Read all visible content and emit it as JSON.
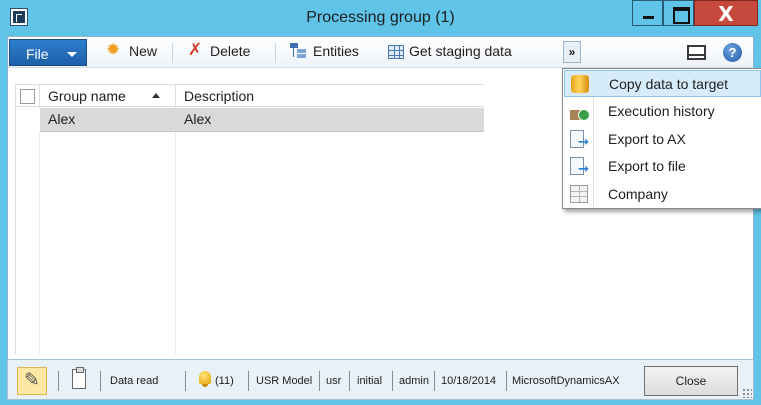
{
  "window": {
    "title": "Processing group (1)",
    "close_glyph": "X"
  },
  "toolbar": {
    "file_label": "File",
    "new_label": "New",
    "delete_label": "Delete",
    "entities_label": "Entities",
    "get_staging_label": "Get staging data",
    "more_glyph": "»",
    "help_glyph": "?"
  },
  "grid": {
    "columns": [
      "Group name",
      "Description"
    ],
    "sort_column": "Group name",
    "sort_direction": "ascending",
    "rows": [
      {
        "group_name": "Alex",
        "description": "Alex",
        "selected": true
      }
    ]
  },
  "menu": {
    "items": [
      {
        "label": "Copy data to target",
        "icon": "cylinder-icon",
        "active": true
      },
      {
        "label": "Execution history",
        "icon": "history-icon",
        "active": false
      },
      {
        "label": "Export to AX",
        "icon": "export-document-icon",
        "active": false
      },
      {
        "label": "Export to file",
        "icon": "export-document-icon",
        "active": false
      },
      {
        "label": "Company",
        "icon": "company-grid-icon",
        "active": false
      }
    ]
  },
  "statusbar": {
    "status": "Data read",
    "notifications": "(11)",
    "model": "USR Model",
    "layer": "usr",
    "partition": "initial",
    "user": "admin",
    "date": "10/18/2014",
    "database": "MicrosoftDynamicsAX",
    "close_label": "Close"
  },
  "colors": {
    "frame": "#5fc4e8",
    "file_button": "#2f7fd0",
    "selected_row": "#d9d9d9",
    "menu_highlight": "#d7ecfb",
    "close_button_chrome": "#c7493d",
    "edit_mode": "#fde9a4"
  }
}
